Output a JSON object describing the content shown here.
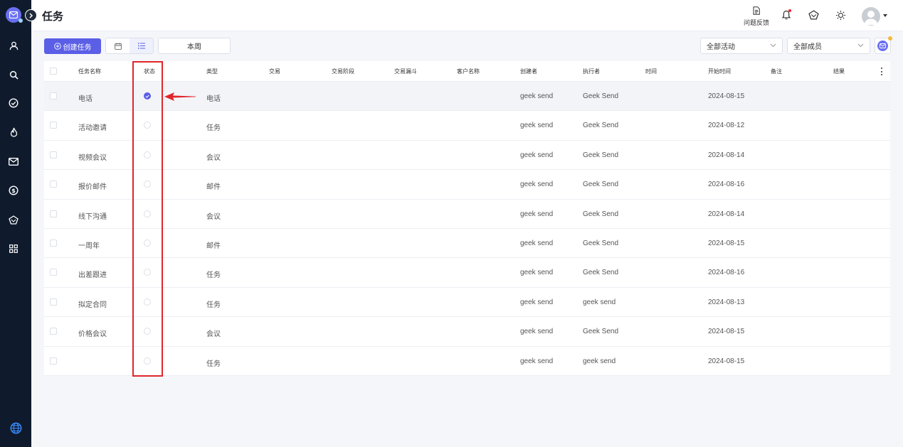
{
  "header": {
    "title": "任务",
    "feedback_label": "问题反馈"
  },
  "toolbar": {
    "create_label": "创建任务",
    "week_label": "本周",
    "activity_filter": "全部活动",
    "member_filter": "全部成员"
  },
  "table": {
    "columns": [
      "任务名称",
      "状态",
      "类型",
      "交易",
      "交易阶段",
      "交易漏斗",
      "客户名称",
      "创建者",
      "执行者",
      "时间",
      "开始时间",
      "备注",
      "结果"
    ],
    "rows": [
      {
        "name": "电话",
        "done": true,
        "type": "电话",
        "creator": "geek send",
        "assignee": "Geek Send",
        "start": "2024-08-15"
      },
      {
        "name": "活动邀请",
        "done": false,
        "type": "任务",
        "creator": "geek send",
        "assignee": "Geek Send",
        "start": "2024-08-12"
      },
      {
        "name": "视频会议",
        "done": false,
        "type": "会议",
        "creator": "geek send",
        "assignee": "Geek Send",
        "start": "2024-08-14"
      },
      {
        "name": "报价邮件",
        "done": false,
        "type": "邮件",
        "creator": "geek send",
        "assignee": "Geek Send",
        "start": "2024-08-16"
      },
      {
        "name": "线下沟通",
        "done": false,
        "type": "会议",
        "creator": "geek send",
        "assignee": "Geek Send",
        "start": "2024-08-14"
      },
      {
        "name": "一周年",
        "done": false,
        "type": "邮件",
        "creator": "geek send",
        "assignee": "Geek Send",
        "start": "2024-08-15"
      },
      {
        "name": "出差跟进",
        "done": false,
        "type": "任务",
        "creator": "geek send",
        "assignee": "Geek Send",
        "start": "2024-08-16"
      },
      {
        "name": "拟定合同",
        "done": false,
        "type": "任务",
        "creator": "geek send",
        "assignee": "geek send",
        "start": "2024-08-13"
      },
      {
        "name": "价格会议",
        "done": false,
        "type": "会议",
        "creator": "geek send",
        "assignee": "Geek Send",
        "start": "2024-08-15"
      },
      {
        "name": "",
        "done": false,
        "type": "任务",
        "creator": "geek send",
        "assignee": "geek send",
        "start": "2024-08-15"
      }
    ]
  },
  "sidebar": {
    "icons": [
      "contact-icon",
      "search-icon",
      "task-check-icon",
      "fire-icon",
      "mail-icon",
      "dollar-icon",
      "crown-icon",
      "apps-grid-icon"
    ]
  },
  "colors": {
    "primary": "#5b5fe6",
    "sidebar": "#0f1b2d",
    "annotation": "#e0262c"
  }
}
